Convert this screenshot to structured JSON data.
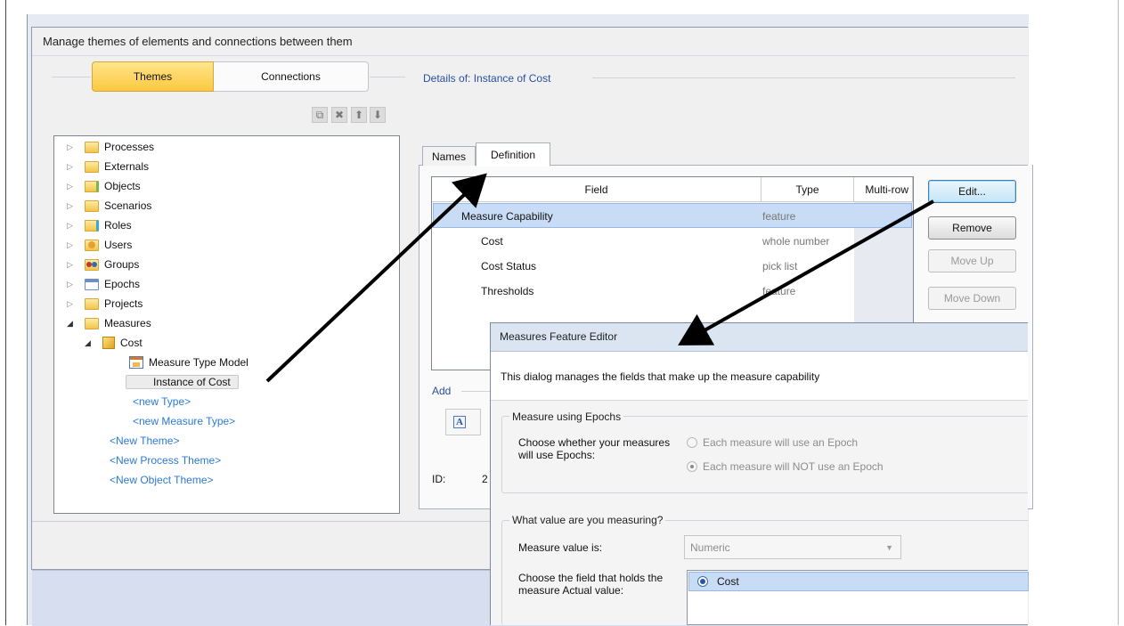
{
  "window": {
    "title": "Manage themes of elements and connections between them"
  },
  "view_tabs": {
    "themes": "Themes",
    "connections": "Connections"
  },
  "toolbar": {
    "copy": "⧉",
    "delete": "✖",
    "up": "⬆",
    "down": "⬇"
  },
  "details": {
    "header": "Details of: Instance of Cost",
    "tabs": [
      "Names",
      "Definition"
    ],
    "add_label": "Add",
    "id_label": "ID:",
    "id_value": "2"
  },
  "tree": {
    "items": [
      {
        "label": "Processes"
      },
      {
        "label": "Externals"
      },
      {
        "label": "Objects"
      },
      {
        "label": "Scenarios"
      },
      {
        "label": "Roles"
      },
      {
        "label": "Users"
      },
      {
        "label": "Groups"
      },
      {
        "label": "Epochs"
      },
      {
        "label": "Projects"
      },
      {
        "label": "Measures"
      },
      {
        "label": "Cost"
      },
      {
        "label": "Measure Type Model"
      },
      {
        "label": "Instance of Cost"
      },
      {
        "label": "<new Type>"
      },
      {
        "label": "<new Measure Type>"
      },
      {
        "label": "<New Theme>"
      },
      {
        "label": "<New Process Theme>"
      },
      {
        "label": "<New Object Theme>"
      }
    ]
  },
  "grid": {
    "headers": [
      "Field",
      "Type",
      "Multi-row"
    ],
    "rows": [
      {
        "field": "Measure Capability",
        "type": "feature"
      },
      {
        "field": "Cost",
        "type": "whole number"
      },
      {
        "field": "Cost Status",
        "type": "pick list"
      },
      {
        "field": "Thresholds",
        "type": "feature"
      }
    ]
  },
  "side_buttons": {
    "edit": "Edit...",
    "remove": "Remove",
    "move_up": "Move Up",
    "move_down": "Move Down"
  },
  "dialog": {
    "title": "Measures Feature Editor",
    "description": "This dialog manages the fields that make up the measure capability",
    "group1": {
      "title": "Measure using Epochs",
      "prompt": "Choose whether your measures will use Epochs:",
      "option1": "Each measure will use an Epoch",
      "option2": "Each measure will NOT use an Epoch"
    },
    "group2": {
      "title": "What value are you measuring?",
      "value_label": "Measure value is:",
      "value_selected": "Numeric",
      "field_label": "Choose the field that holds the measure Actual value:",
      "field_option": "Cost"
    }
  },
  "colors": {
    "accent_tab": "#fcc840",
    "link": "#2b7ad8",
    "selection": "#c9dcf5"
  }
}
